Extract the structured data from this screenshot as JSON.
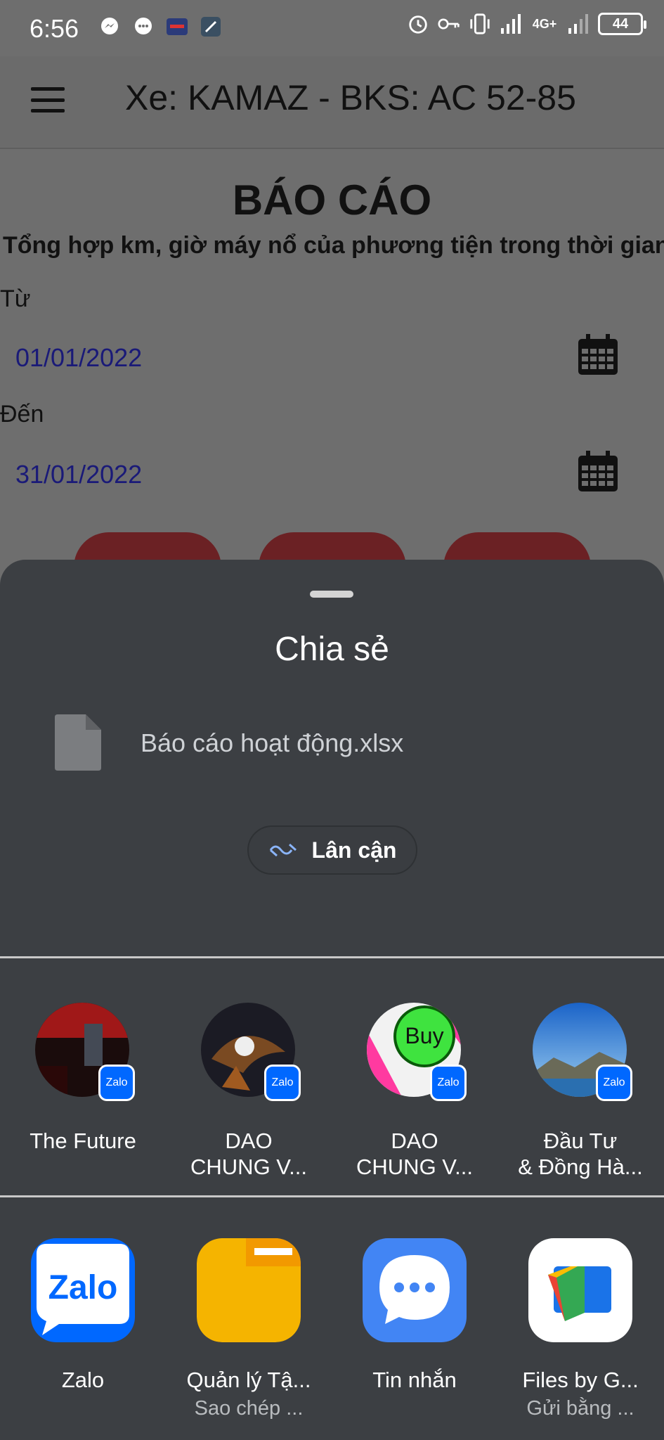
{
  "status_bar": {
    "time": "6:56",
    "battery": "44",
    "network": "4G+"
  },
  "app_bar": {
    "title": "Xe: KAMAZ - BKS: AC 52-85"
  },
  "report": {
    "title": "BÁO CÁO",
    "subtitle": "Tổng hợp km, giờ máy nổ của phương tiện trong thời gian",
    "from_label": "Từ",
    "from_value": "01/01/2022",
    "to_label": "Đến",
    "to_value": "31/01/2022"
  },
  "share_sheet": {
    "title": "Chia sẻ",
    "file_name": "Báo cáo hoạt động.xlsx",
    "nearby_label": "Lân cận",
    "contacts": [
      {
        "line1": "The Future",
        "line2": "",
        "badge": "Zalo"
      },
      {
        "line1": "DAO",
        "line2": "CHUNG V...",
        "badge": "Zalo"
      },
      {
        "line1": "DAO",
        "line2": "CHUNG V...",
        "badge": "Zalo",
        "avatar_text": "Buy"
      },
      {
        "line1": "Đầu Tư",
        "line2": "& Đồng Hà...",
        "badge": "Zalo"
      }
    ],
    "apps": [
      {
        "name": "Zalo",
        "sub": "",
        "icon_text": "Zalo"
      },
      {
        "name": "Quản lý Tậ...",
        "sub": "Sao chép ..."
      },
      {
        "name": "Tin nhắn",
        "sub": ""
      },
      {
        "name": "Files by G...",
        "sub": "Gửi bằng ..."
      }
    ]
  },
  "colors": {
    "sheet_bg": "#3c3f43",
    "dim_bg": "#6e6e6e",
    "date_text": "#1a1a78",
    "zalo_blue": "#0068ff",
    "files_yellow": "#f5b400",
    "messages_blue": "#4285f4"
  }
}
